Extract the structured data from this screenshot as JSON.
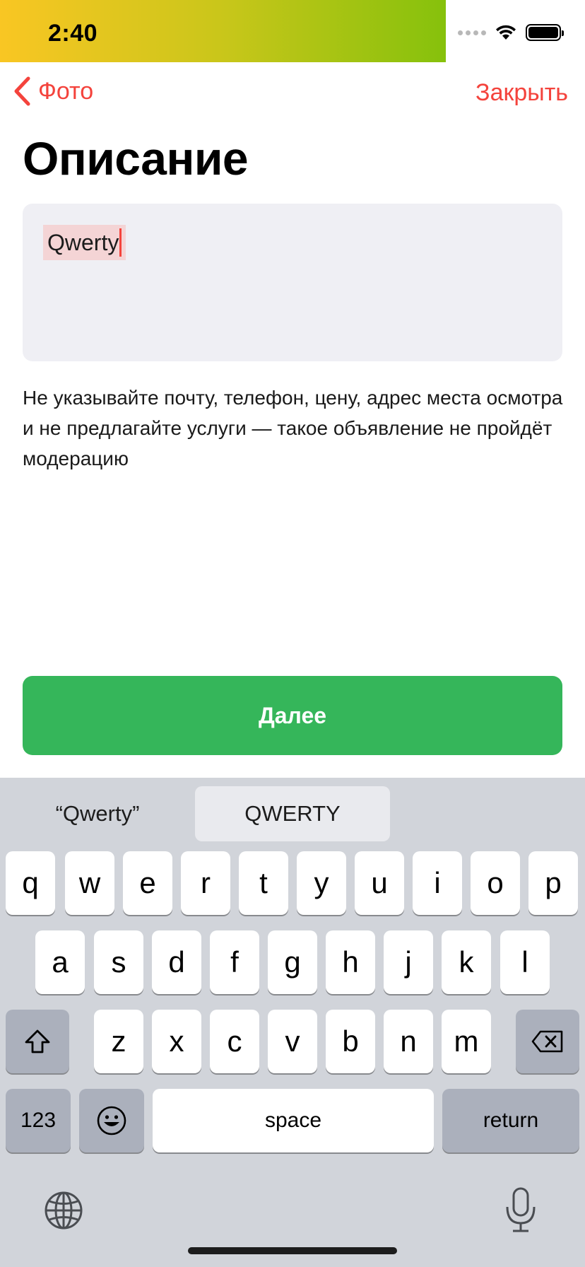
{
  "status_bar": {
    "time": "2:40"
  },
  "nav": {
    "back_label": "Фото",
    "close_label": "Закрыть"
  },
  "page": {
    "title": "Описание",
    "description_value": "Qwerty",
    "hint_text": "Не указывайте почту, телефон, цену, адрес места осмотра и не предлагайте услуги — такое объявление не пройдёт модерацию",
    "next_label": "Далее"
  },
  "keyboard": {
    "suggestions": [
      "“Qwerty”",
      "QWERTY",
      ""
    ],
    "row1": [
      "q",
      "w",
      "e",
      "r",
      "t",
      "y",
      "u",
      "i",
      "o",
      "p"
    ],
    "row2": [
      "a",
      "s",
      "d",
      "f",
      "g",
      "h",
      "j",
      "k",
      "l"
    ],
    "row3": [
      "z",
      "x",
      "c",
      "v",
      "b",
      "n",
      "m"
    ],
    "numbers_label": "123",
    "space_label": "space",
    "return_label": "return"
  },
  "colors": {
    "accent": "#f4433c",
    "primary_button": "#35b65a",
    "input_bg": "#efeff4",
    "keyboard_bg": "#d1d4da"
  }
}
